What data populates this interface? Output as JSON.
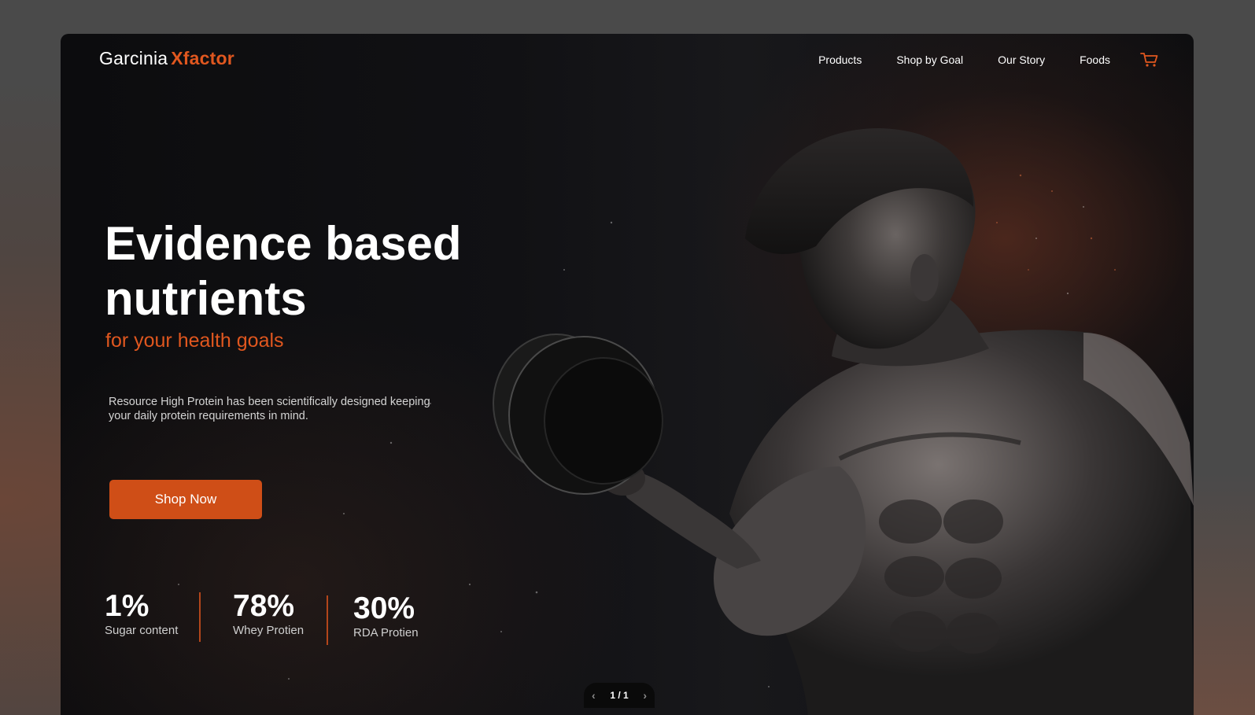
{
  "brand": {
    "name": "Garcinia",
    "accent": "Xfactor",
    "accent_color": "#e0571f"
  },
  "nav": {
    "items": [
      "Products",
      "Shop by Goal",
      "Our Story",
      "Foods"
    ],
    "cart_icon": "cart-icon"
  },
  "hero": {
    "headline_line1": "Evidence based",
    "headline_line2": "nutrients",
    "subheadline": "for your health goals",
    "description": "Resource High Protein has been scientifically designed keeping your daily protein requirements in mind.",
    "cta_label": "Shop Now",
    "cta_color": "#cf4e17"
  },
  "stats": [
    {
      "value": "1%",
      "label": "Sugar content"
    },
    {
      "value": "78%",
      "label": "Whey Protien"
    },
    {
      "value": "30%",
      "label": "RDA Protien"
    }
  ],
  "pager": {
    "text": "1 / 1",
    "prev_icon": "chevron-left-icon",
    "next_icon": "chevron-right-icon"
  }
}
